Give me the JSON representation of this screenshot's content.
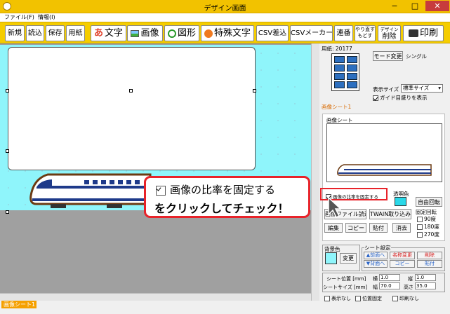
{
  "window": {
    "title": "デザイン画面",
    "controls": [
      "−",
      "□",
      "✕"
    ]
  },
  "menu": [
    "ファイル(F)",
    "情報(I)"
  ],
  "toolbar": {
    "new": "新規",
    "open": "読込",
    "save": "保存",
    "paper": "用紙",
    "text": "文字",
    "image": "画像",
    "shape": "図形",
    "special_text": "特殊文字",
    "csv_insert": "CSV差込",
    "csv_maker": "CSVメーカー",
    "sequence": "連番",
    "redo_line1": "やり直す",
    "redo_line2": "もどす",
    "design_delete_line1": "デザイン",
    "design_delete_line2": "削除",
    "print": "印刷"
  },
  "right_panel": {
    "paper_label": "用紙: 20177",
    "mode_change": "モード変更",
    "mode_value": "シングル",
    "display_size_label": "表示サイズ",
    "display_size_value": "標準サイズ",
    "guide_checkbox": "ガイド目盛りを表示",
    "image_sheet_tab": "画像シート1",
    "image_sheet_group": "画像シート",
    "fix_ratio": "画像の比率を固定する",
    "transparent_color": "透明色",
    "free_rotate": "自由回転",
    "fixed_rotate": "固定回転",
    "rot90": "90度",
    "rot180": "180度",
    "rot270": "270度",
    "image_file_load": "画像ファイル読込",
    "twain_load": "TWAIN取り込み",
    "edit": "編集",
    "copy": "コピー",
    "paste": "貼付",
    "erase": "消去",
    "bg_color": "背景色",
    "change": "変更",
    "sheet_setting": "シート設定",
    "to_front": "▲前面へ",
    "to_back": "▼背面へ",
    "rename": "名称変更",
    "delete": "削除",
    "sheet_copy": "コピー",
    "sheet_paste": "貼付",
    "sheet_pos_label": "シート位置 [mm]",
    "sheet_size_label": "シートサイズ [mm]",
    "x_label": "横",
    "x_value": "1.0",
    "y_label": "縦",
    "y_value": "1.0",
    "w_label": "幅",
    "w_value": "70.0",
    "h_label": "高さ",
    "h_value": "35.0",
    "hide": "表示なし",
    "pos_fixed": "位置固定",
    "no_print": "印刷なし"
  },
  "sheet_tab": "画像シート1",
  "callout": {
    "line1": "画像の比率を固定する",
    "line2": "をクリックしてチェック！"
  },
  "colors": {
    "titlebar": "#f2c200",
    "toolbar": "#f5cd00",
    "canvas_bg": "#8ff5fb",
    "callout_border": "#e8232a",
    "sheet_tab": "#f5a000"
  }
}
